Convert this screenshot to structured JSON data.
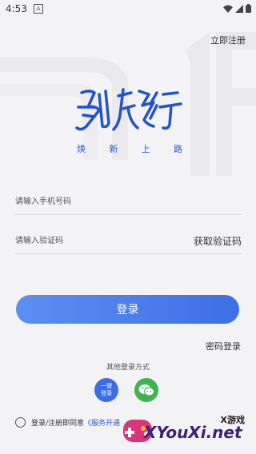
{
  "status_bar": {
    "time": "4:53",
    "notif_badge": "A"
  },
  "header": {
    "register_label": "立即注册"
  },
  "brand": {
    "tagline_chars": [
      "焕",
      "新",
      "上",
      "路"
    ]
  },
  "form": {
    "phone_placeholder": "请输入手机号码",
    "code_placeholder": "请输入验证码",
    "get_code_label": "获取验证码",
    "login_label": "登录",
    "password_login_label": "密码登录"
  },
  "other_login": {
    "title": "其他登录方式",
    "onekey_line1": "一键",
    "onekey_line2": "登录",
    "wechat_icon": "wechat-icon"
  },
  "agreement": {
    "text": "登录/注册即同意",
    "link": "《服务开通"
  },
  "watermark": {
    "game_text": "X游戏",
    "site_text": "XYouXi.net"
  },
  "colors": {
    "accent": "#3d6fe6",
    "wechat": "#3fb34f",
    "brand_blue": "#2f58d6"
  }
}
